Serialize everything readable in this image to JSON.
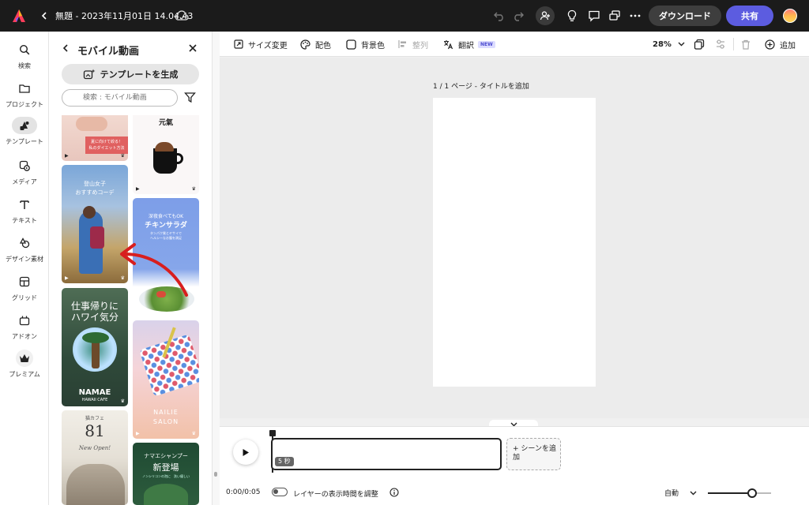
{
  "topbar": {
    "title": "無題 - 2023年11月01日 14.04.43",
    "download": "ダウンロード",
    "share": "共有"
  },
  "rail": {
    "items": [
      {
        "label": "検索",
        "icon": "search-icon"
      },
      {
        "label": "プロジェクト",
        "icon": "folder-icon"
      },
      {
        "label": "テンプレート",
        "icon": "templates-icon"
      },
      {
        "label": "メディア",
        "icon": "media-icon"
      },
      {
        "label": "テキスト",
        "icon": "text-icon"
      },
      {
        "label": "デザイン素材",
        "icon": "shapes-icon"
      },
      {
        "label": "グリッド",
        "icon": "grid-icon"
      },
      {
        "label": "アドオン",
        "icon": "addon-icon"
      },
      {
        "label": "プレミアム",
        "icon": "premium-icon"
      }
    ]
  },
  "panel": {
    "title": "モバイル動画",
    "generate": "テンプレートを生成",
    "search_placeholder": "検索 : モバイル動画",
    "thumbs": {
      "diet": "夏に向けて絞る！\n私のダイエット方法",
      "cafe_header": "元氣",
      "mountain_1": "登山女子",
      "mountain_2": "おすすめコーデ",
      "salad_1": "深夜食べてもOK",
      "salad_2": "チキンサラダ",
      "salad_3": "タンパク質とヤサイで\nヘルシーなお腹を満足",
      "hawaii_1": "仕事帰りに",
      "hawaii_2": "ハワイ気分",
      "hawaii_3": "NAMAE",
      "hawaii_4": "HAWAII CAFE",
      "nail_1": "NAILIE",
      "nail_2": "SALON",
      "cat_1": "猫カフェ",
      "cat_2": "81",
      "cat_3": "New Open!",
      "shampoo_1": "ナマエシャンプー",
      "shampoo_2": "新登場",
      "shampoo_3": "ノンシリコンの泡に　洗い優しい"
    }
  },
  "toolbar": {
    "resize": "サイズ変更",
    "color": "配色",
    "background": "背景色",
    "align": "整列",
    "translate": "翻訳",
    "new_badge": "NEW",
    "zoom": "28%",
    "add": "追加"
  },
  "canvas": {
    "page_label": "1 / 1 ページ - タイトルを追加"
  },
  "timeline": {
    "scene_duration": "5 秒",
    "add_scene": "+ シーンを追\n加",
    "time": "0:00/0:05",
    "layer_toggle": "レイヤーの表示時間を調整",
    "auto": "自動",
    "zoom_slider": 0.7
  }
}
